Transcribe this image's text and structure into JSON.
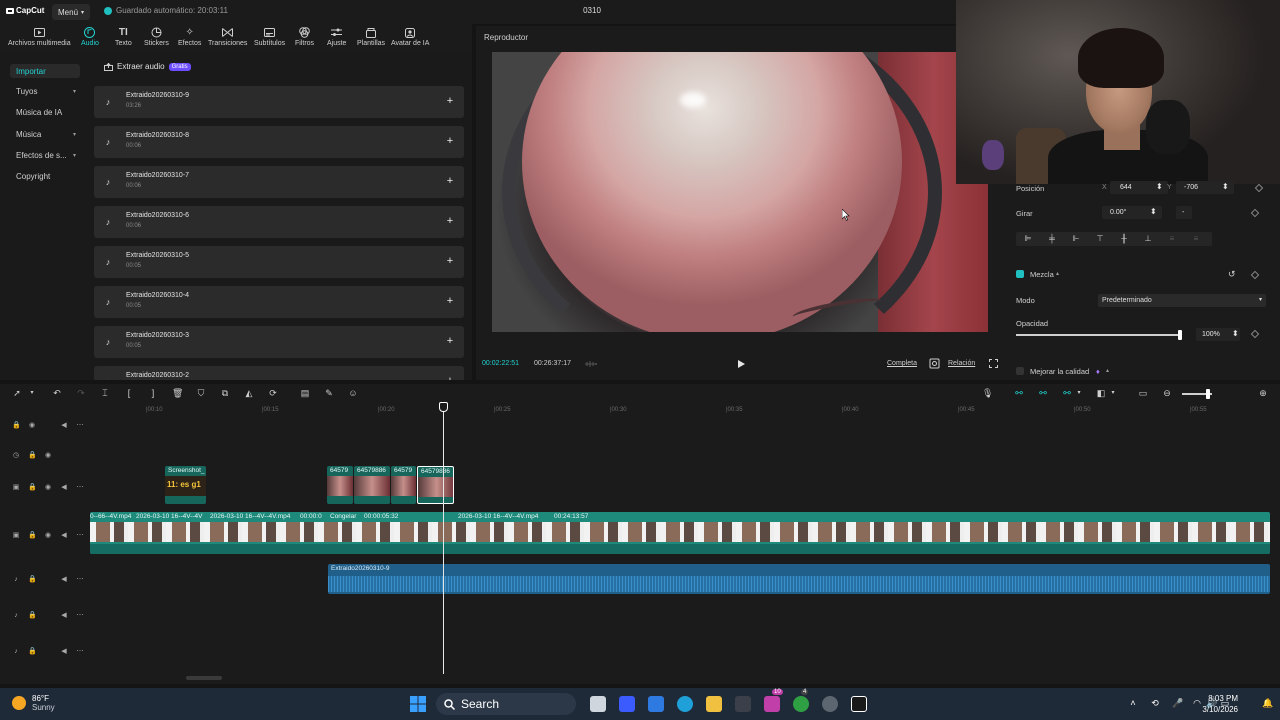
{
  "app": {
    "logo": "CapCut",
    "menu_label": "Menú",
    "autosave": "Guardado automático: 20:03:11",
    "project_title": "0310"
  },
  "toolbar": {
    "items": [
      {
        "label": "Archivos multimedia",
        "icon": "media-icon"
      },
      {
        "label": "Audio",
        "icon": "audio-icon",
        "active": true
      },
      {
        "label": "Texto",
        "icon": "text-icon"
      },
      {
        "label": "Stickers",
        "icon": "sticker-icon"
      },
      {
        "label": "Efectos",
        "icon": "effects-icon"
      },
      {
        "label": "Transiciones",
        "icon": "transitions-icon"
      },
      {
        "label": "Subtítulos",
        "icon": "subtitles-icon"
      },
      {
        "label": "Filtros",
        "icon": "filters-icon"
      },
      {
        "label": "Ajuste",
        "icon": "adjust-icon"
      },
      {
        "label": "Plantillas",
        "icon": "templates-icon"
      },
      {
        "label": "Avatar de IA",
        "icon": "avatar-icon"
      }
    ]
  },
  "sidebar": {
    "items": [
      {
        "label": "Importar",
        "active": true
      },
      {
        "label": "Tuyos",
        "chevron": true
      },
      {
        "label": "Música de IA"
      },
      {
        "label": "Música",
        "chevron": true
      },
      {
        "label": "Efectos de s...",
        "chevron": true
      },
      {
        "label": "Copyright"
      }
    ]
  },
  "media": {
    "extract_label": "Extraer audio",
    "badge": "Gratis",
    "items": [
      {
        "name": "Extraido20260310-9",
        "duration": "03:26"
      },
      {
        "name": "Extraido20260310-8",
        "duration": "00:06"
      },
      {
        "name": "Extraido20260310-7",
        "duration": "00:06"
      },
      {
        "name": "Extraido20260310-6",
        "duration": "00:06"
      },
      {
        "name": "Extraido20260310-5",
        "duration": "00:05"
      },
      {
        "name": "Extraido20260310-4",
        "duration": "00:05"
      },
      {
        "name": "Extraido20260310-3",
        "duration": "00:05"
      },
      {
        "name": "Extraido20260310-2",
        "duration": ""
      }
    ]
  },
  "player": {
    "title": "Reproductor",
    "current_time": "00:02:22:51",
    "total_time": "00:26:37:17",
    "complete_label": "Completa",
    "ratio_label": "Relación"
  },
  "properties": {
    "position_label": "Posición",
    "x_label": "X",
    "x_value": "644",
    "y_label": "Y",
    "y_value": "-706",
    "rotate_label": "Girar",
    "rotate_value": "0.00°",
    "rotate_dash": "-",
    "blend_label": "Mezcla",
    "mode_label": "Modo",
    "mode_value": "Predeterminado",
    "opacity_label": "Opacidad",
    "opacity_value": "100%",
    "opacity_fraction": 1.0,
    "enhance_label": "Mejorar la calidad"
  },
  "ruler": {
    "ticks": [
      "|00:10",
      "|00:15",
      "|00:20",
      "|00:25",
      "|00:30",
      "|00:35",
      "|00:40",
      "|00:45",
      "|00:50",
      "|00:55"
    ]
  },
  "timeline": {
    "screenshot_clip": {
      "label": "Screenshot_",
      "caption": "11: es g1"
    },
    "small_clips": [
      "64579",
      "64579886",
      "64579",
      "64579886"
    ],
    "main_clips": [
      {
        "label": "0--66--4V.mp4"
      },
      {
        "label": "2026-03-10 16--4V--4V"
      },
      {
        "label": "2026-03-10 16--4V--4V.mp4"
      },
      {
        "label": "00:00:0"
      },
      {
        "label": "Congelar"
      },
      {
        "label": "00:00:05:32"
      },
      {
        "label": "2026-03-10 16--4V--4V.mp4"
      },
      {
        "label": "00:24:13:57"
      }
    ],
    "audio_clip": "Extraido20260310-9"
  },
  "taskbar": {
    "temperature": "86°F",
    "condition": "Sunny",
    "search_label": "Search",
    "time": "8:03 PM",
    "date": "3/10/2026",
    "badge_count": "10",
    "badge_count_2": "4"
  },
  "colors": {
    "accent": "#22d3d3",
    "clip_teal": "#1d8a7c",
    "audio_blue": "#1f5f8a"
  }
}
